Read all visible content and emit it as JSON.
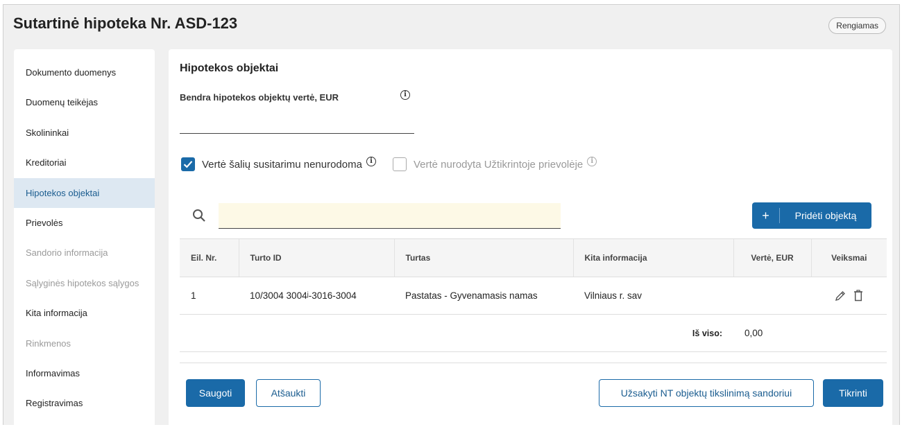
{
  "header": {
    "title": "Sutartinė hipoteka Nr. ASD-123",
    "status": "Rengiamas"
  },
  "sidebar": {
    "items": [
      {
        "label": "Dokumento duomenys",
        "state": "normal"
      },
      {
        "label": "Duomenų teikėjas",
        "state": "normal"
      },
      {
        "label": "Skolininkai",
        "state": "normal"
      },
      {
        "label": "Kreditoriai",
        "state": "normal"
      },
      {
        "label": "Hipotekos objektai",
        "state": "active"
      },
      {
        "label": "Prievolės",
        "state": "normal"
      },
      {
        "label": "Sandorio informacija",
        "state": "disabled"
      },
      {
        "label": "Sąlyginės hipotekos sąlygos",
        "state": "disabled"
      },
      {
        "label": "Kita informacija",
        "state": "normal"
      },
      {
        "label": "Rinkmenos",
        "state": "disabled"
      },
      {
        "label": "Informavimas",
        "state": "normal"
      },
      {
        "label": "Registravimas",
        "state": "normal"
      }
    ]
  },
  "main": {
    "section_title": "Hipotekos objektai",
    "total_value_label": "Bendra hipotekos objektų vertė, EUR",
    "total_value": "",
    "checkbox_unspecified": {
      "label": "Vertė šalių susitarimu nenurodoma",
      "checked": true
    },
    "checkbox_in_obligation": {
      "label": "Vertė nurodyta Užtikrintoje prievolėje",
      "checked": false
    },
    "search": {
      "value": "",
      "placeholder": ""
    },
    "add_button": {
      "icon": "+",
      "label": "Pridėti objektą"
    },
    "table": {
      "columns": [
        "Eil. Nr.",
        "Turto ID",
        "Turtas",
        "Kita informacija",
        "Vertė, EUR",
        "Veiksmai"
      ],
      "rows": [
        {
          "no": "1",
          "id": "10/3004 3004ʲ-3016-3004",
          "property": "Pastatas - Gyvenamasis namas",
          "other": "Vilniaus r. sav",
          "value": ""
        }
      ],
      "total_label": "Iš viso:",
      "total_value": "0,00"
    }
  },
  "footer": {
    "save": "Saugoti",
    "cancel": "Atšaukti",
    "order": "Užsakyti NT objektų tikslinimą sandoriui",
    "check": "Tikrinti"
  },
  "colors": {
    "primary": "#1a6aa8",
    "active_bg": "#dde8f2",
    "search_bg": "#fdf9e6"
  },
  "icons": {
    "info": "info-icon",
    "search": "search-icon",
    "edit": "pencil-icon",
    "delete": "trash-icon",
    "check": "checkmark-icon"
  }
}
